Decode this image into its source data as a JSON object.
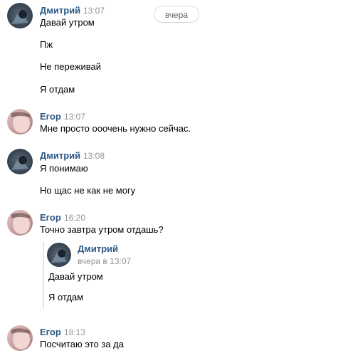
{
  "date_divider": "вчера",
  "groups": [
    {
      "author": "Дмитрий",
      "time": "13:07",
      "avatar_icon": "user-avatar-dmitry",
      "messages": [
        "Давай утром",
        "Пж",
        "Не переживай",
        "Я отдам"
      ]
    },
    {
      "author": "Егор",
      "time": "13:07",
      "avatar_icon": "user-avatar-egor",
      "messages": [
        "Мне просто ооочень нужно сейчас."
      ]
    },
    {
      "author": "Дмитрий",
      "time": "13:08",
      "avatar_icon": "user-avatar-dmitry",
      "messages": [
        "Я понимаю",
        "Но щас не как не могу"
      ]
    },
    {
      "author": "Егор",
      "time": "16:20",
      "avatar_icon": "user-avatar-egor",
      "messages": [
        "Точно завтра утром отдашь?"
      ],
      "forwarded": {
        "author": "Дмитрий",
        "time": "вчера в 13:07",
        "messages": [
          "Давай утром",
          "Я отдам"
        ]
      }
    },
    {
      "author": "Егор",
      "time": "18:13",
      "avatar_icon": "user-avatar-egor",
      "messages": [
        "Посчитаю это за да"
      ]
    }
  ],
  "colors": {
    "author_name": "#2a5885",
    "timestamp": "#939393",
    "divider_border": "#d3d9de"
  }
}
